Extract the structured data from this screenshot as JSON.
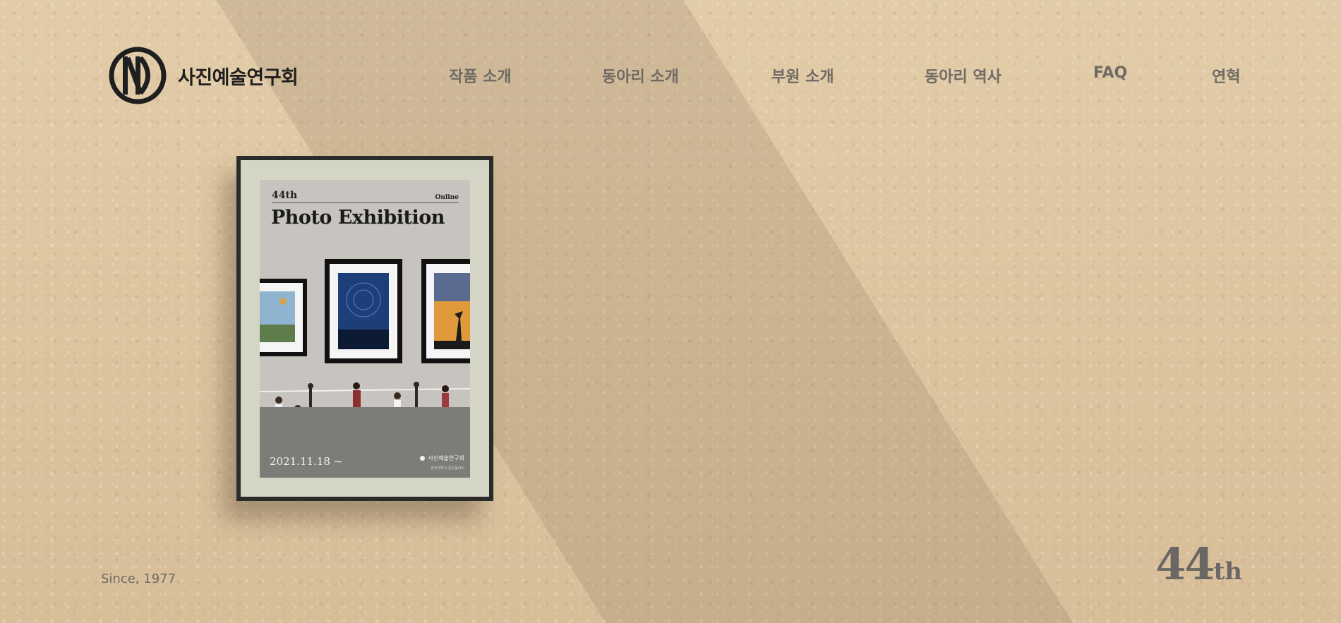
{
  "brand": {
    "name": "사진예술연구회",
    "logo_icon": "club-logo-icon"
  },
  "nav": [
    {
      "label": "작품 소개"
    },
    {
      "label": "동아리 소개"
    },
    {
      "label": "부원 소개"
    },
    {
      "label": "동아리 역사"
    },
    {
      "label": "FAQ"
    },
    {
      "label": "연혁"
    }
  ],
  "poster": {
    "edition": "44th",
    "online": "Online",
    "title": "Photo Exhibition",
    "date": "2021.11.18 ~",
    "org": "사진예술연구회",
    "org_sub": "한국대학교 중앙동아리"
  },
  "footer": {
    "since": "Since, 1977",
    "edition_number": "44",
    "edition_suffix": "th"
  },
  "colors": {
    "background": "#ddc4a0",
    "nav_text": "#6e6a64",
    "brand_text": "#1f1f1f",
    "frame": "#2b2b2b",
    "mat": "#d4d5c4"
  }
}
